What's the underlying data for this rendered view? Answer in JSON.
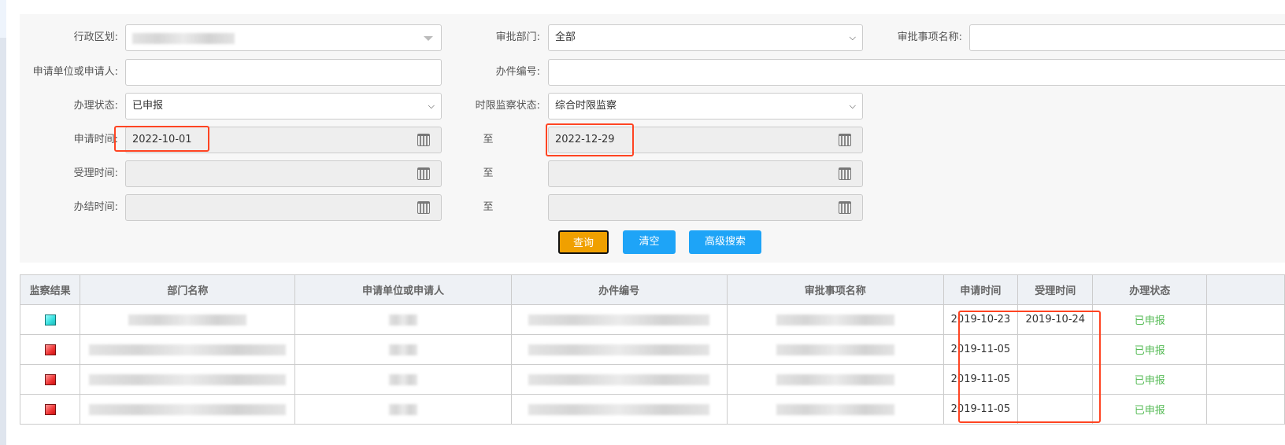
{
  "form": {
    "region_label": "行政区划:",
    "dept_label": "审批部门:",
    "dept_value": "全部",
    "item_label": "审批事项名称:",
    "applicant_label": "申请单位或申请人:",
    "case_no_label": "办件编号:",
    "status_label": "办理状态:",
    "status_value": "已申报",
    "monitor_label": "时限监察状态:",
    "monitor_value": "综合时限监察",
    "apply_time_label": "申请时间:",
    "apply_from": "2022-10-01",
    "to_label": "至",
    "apply_to": "2022-12-29",
    "accept_time_label": "受理时间:",
    "finish_time_label": "办结时间:"
  },
  "buttons": {
    "query": "查询",
    "clear": "清空",
    "advanced": "高级搜索"
  },
  "table": {
    "headers": [
      "监察结果",
      "部门名称",
      "申请单位或申请人",
      "办件编号",
      "审批事项名称",
      "申请时间",
      "受理时间",
      "办理状态"
    ],
    "rows": [
      {
        "result": "cyan",
        "apply_time": "2019-10-23",
        "accept_time": "2019-10-24",
        "status": "已申报"
      },
      {
        "result": "red",
        "apply_time": "2019-11-05",
        "accept_time": "",
        "status": "已申报"
      },
      {
        "result": "red",
        "apply_time": "2019-11-05",
        "accept_time": "",
        "status": "已申报"
      },
      {
        "result": "red",
        "apply_time": "2019-11-05",
        "accept_time": "",
        "status": "已申报"
      }
    ]
  },
  "colors": {
    "query": "#f0a000",
    "secondary": "#1ea4f7",
    "ok": "#55bb55",
    "highlight": "#ff2a1a"
  }
}
